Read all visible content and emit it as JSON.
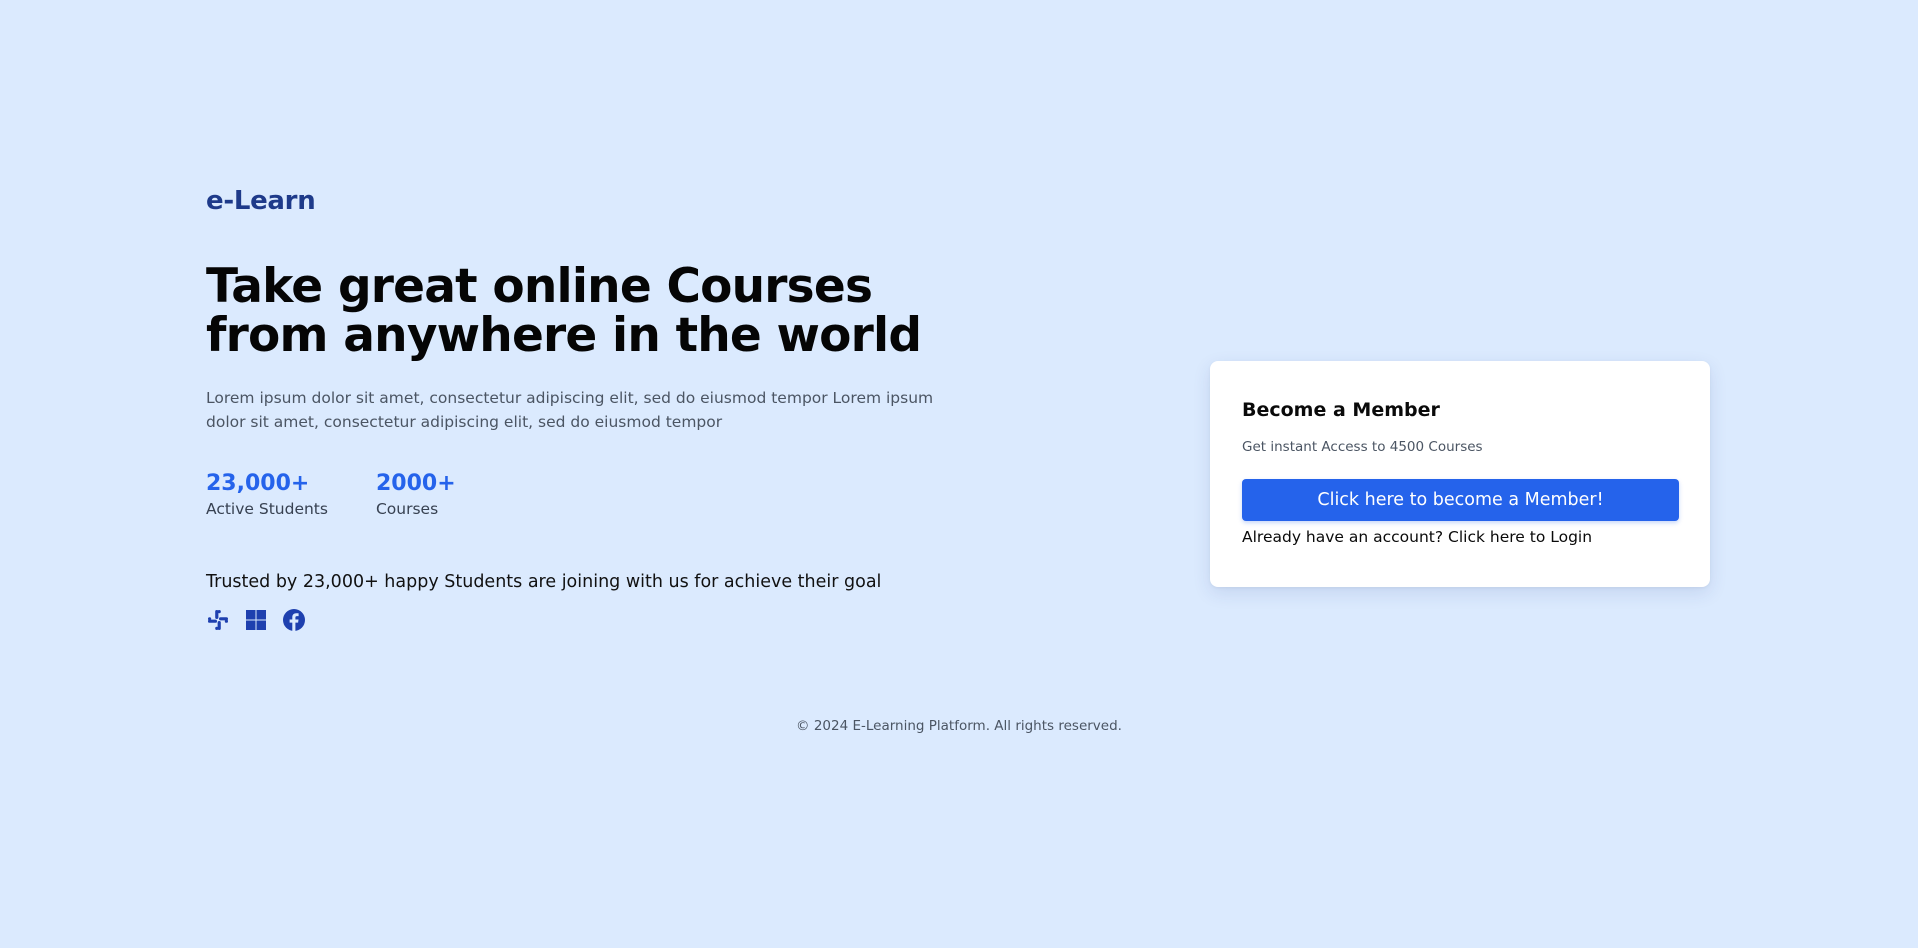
{
  "brand": {
    "logo": "e-Learn"
  },
  "hero": {
    "headline": "Take great online Courses from anywhere in the world",
    "lead": "Lorem ipsum dolor sit amet, consectetur adipiscing elit, sed do eiusmod tempor Lorem ipsum dolor sit amet, consectetur adipiscing elit, sed do eiusmod tempor",
    "stats": [
      {
        "value": "23,000+",
        "label": "Active Students"
      },
      {
        "value": "2000+",
        "label": "Courses"
      }
    ],
    "trusted": "Trusted by 23,000+ happy Students are joining with us for achieve their goal",
    "partner_icons": [
      "slack-icon",
      "windows-icon",
      "facebook-icon"
    ]
  },
  "card": {
    "title": "Become a Member",
    "subtitle": "Get instant Access to 4500 Courses",
    "button_label": "Click here to become a Member!",
    "login_prefix": "Already have an account?",
    "login_link": "Click here to Login"
  },
  "footer": {
    "text": "© 2024 E-Learning Platform. All rights reserved."
  },
  "colors": {
    "background": "#dbeafe",
    "logo": "#1e3a8a",
    "accent": "#2563eb",
    "icons": "#1e40af"
  }
}
